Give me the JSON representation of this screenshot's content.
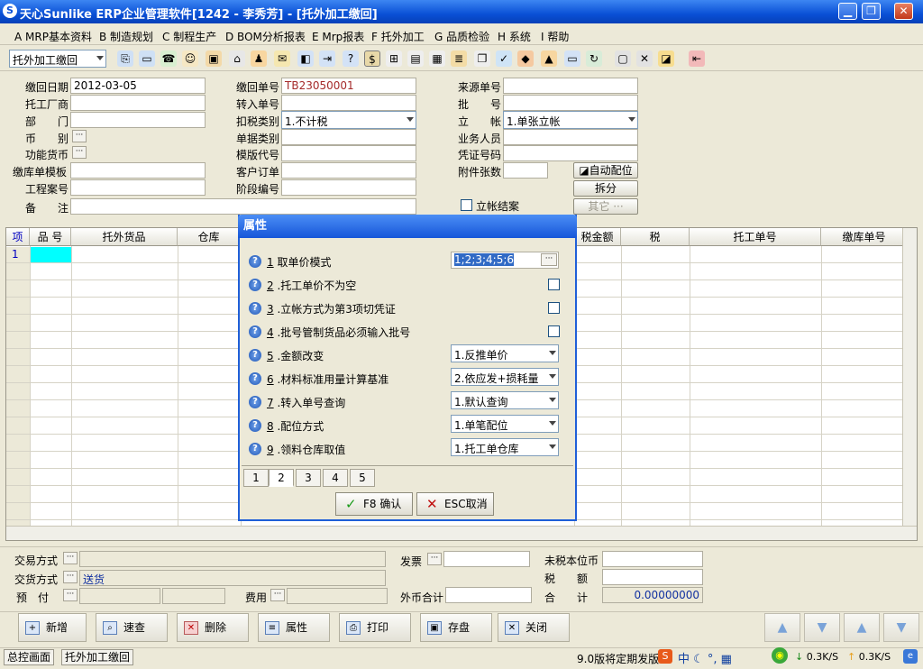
{
  "window": {
    "title": "天心Sunlike ERP企业管理软件[1242 - 李秀芳] - [托外加工缴回]",
    "min": "▁",
    "max": "❐",
    "close": "✕"
  },
  "menu": [
    "A MRP基本资料",
    "B 制造规划",
    "C 制程生产",
    "D BOM分析报表",
    "E Mrp报表",
    "F 托外加工",
    "G 品质检验",
    "H 系统",
    "I 帮助"
  ],
  "toolbar": {
    "module_select": "托外加工缴回"
  },
  "header": {
    "labels": {
      "date": "缴回日期",
      "vendor": "托工厂商",
      "dept": "部　　门",
      "currency": "币　　别",
      "func_currency": "功能货币",
      "template": "缴库单模板",
      "project": "工程案号",
      "remark": "备　　注",
      "no": "缴回单号",
      "transfer_no": "转入单号",
      "tax_type": "扣税类别",
      "doc_type": "单据类别",
      "template_code": "模版代号",
      "customer_order": "客户订单",
      "stage_no": "阶段编号",
      "source_no": "来源单号",
      "batch": "批　　号",
      "account": "立　　帐",
      "salesman": "业务人员",
      "voucher": "凭证号码",
      "attach": "附件张数",
      "settled": "立帐结案"
    },
    "values": {
      "date": "2012-03-05",
      "no": "TB23050001",
      "tax_type": "1.不计税",
      "account": "1.单张立帐"
    },
    "buttons": {
      "auto": "自动配位",
      "split": "拆分",
      "other": "其它"
    },
    "dots": "···"
  },
  "grid": {
    "columns": [
      "项",
      "品 号",
      "托外货品",
      "仓库",
      "税金额",
      "税",
      "托工单号",
      "缴库单号"
    ],
    "rows": [
      {
        "idx": "1"
      }
    ]
  },
  "footer": {
    "labels": {
      "trade": "交易方式",
      "delivery": "交货方式",
      "prepay": "预　付",
      "fee": "费用",
      "invoice": "发票",
      "foreign_total": "外币合计",
      "untax": "未税本位币",
      "tax": "税　　额",
      "total": "合　　计"
    },
    "values": {
      "delivery": "送货",
      "total": "0.00000000"
    }
  },
  "buttons": [
    "新增",
    "速查",
    "删除",
    "属性",
    "打印",
    "存盘",
    "关闭"
  ],
  "status": {
    "tab1": "总控画面",
    "tab2": "托外加工缴回",
    "notice": "9.0版将定期发版",
    "net_down": "0.3K/S",
    "net_up": "0.3K/S"
  },
  "dialog": {
    "title": "属性",
    "rows": [
      {
        "num": "1",
        "label": " 取单价模式",
        "value": "1;2;3;4;5;6"
      },
      {
        "num": "2",
        "label": " .托工单价不为空"
      },
      {
        "num": "3",
        "label": " .立帐方式为第3项切凭证"
      },
      {
        "num": "4",
        "label": " .批号管制货品必须输入批号"
      },
      {
        "num": "5",
        "label": " .金额改变",
        "value": "1.反推单价"
      },
      {
        "num": "6",
        "label": " .材料标准用量计算基准",
        "value": "2.依应发+损耗量"
      },
      {
        "num": "7",
        "label": " .转入单号查询",
        "value": "1.默认查询"
      },
      {
        "num": "8",
        "label": " .配位方式",
        "value": "1.单笔配位"
      },
      {
        "num": "9",
        "label": " .领料仓库取值",
        "value": "1.托工单仓库"
      }
    ],
    "tabs": [
      "1",
      "2",
      "3",
      "4",
      "5"
    ],
    "ok": "F8 确认",
    "cancel": "ESC取消"
  }
}
